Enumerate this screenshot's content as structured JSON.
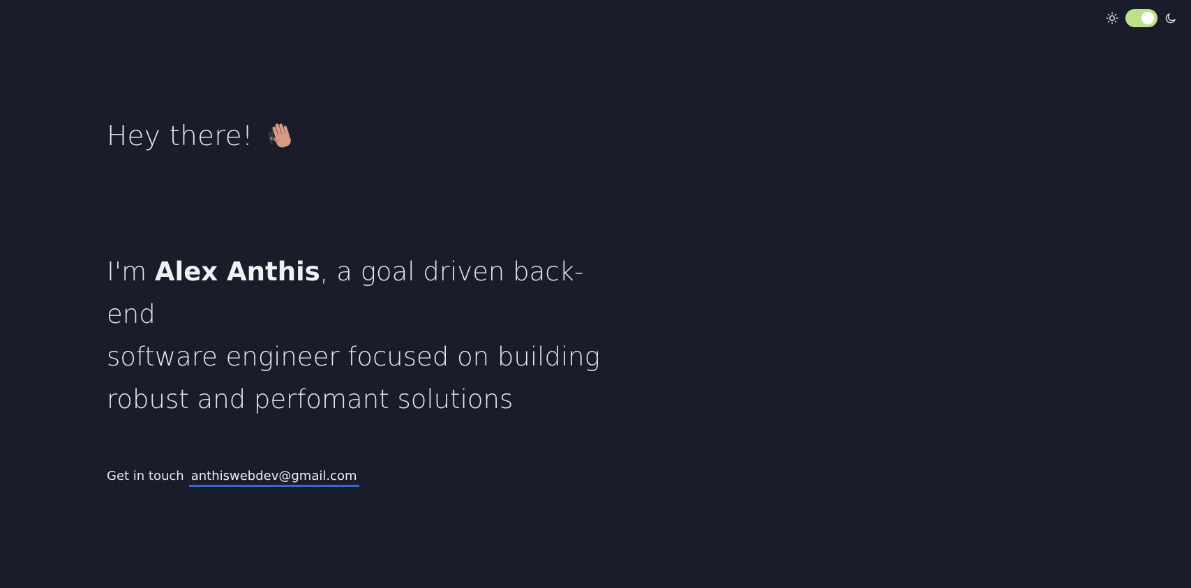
{
  "theme_toggle": {
    "sun_icon": "sun-icon",
    "moon_icon": "moon-icon",
    "state": "on",
    "accent_color": "#bde088"
  },
  "hero": {
    "greeting": "Hey there!",
    "greeting_icon": "waving-hand-icon",
    "intro_prefix": "I'm ",
    "name": "Alex Anthis",
    "intro_line1_suffix": ", a goal driven back-end",
    "intro_line2": "software engineer focused on building",
    "intro_line3": "robust and perfomant solutions"
  },
  "contact": {
    "label": "Get in touch",
    "email": "anthiswebdev@gmail.com",
    "underline_color": "#2f6ad8"
  },
  "colors": {
    "background": "#1a1c29",
    "text": "#e6e7ec"
  }
}
